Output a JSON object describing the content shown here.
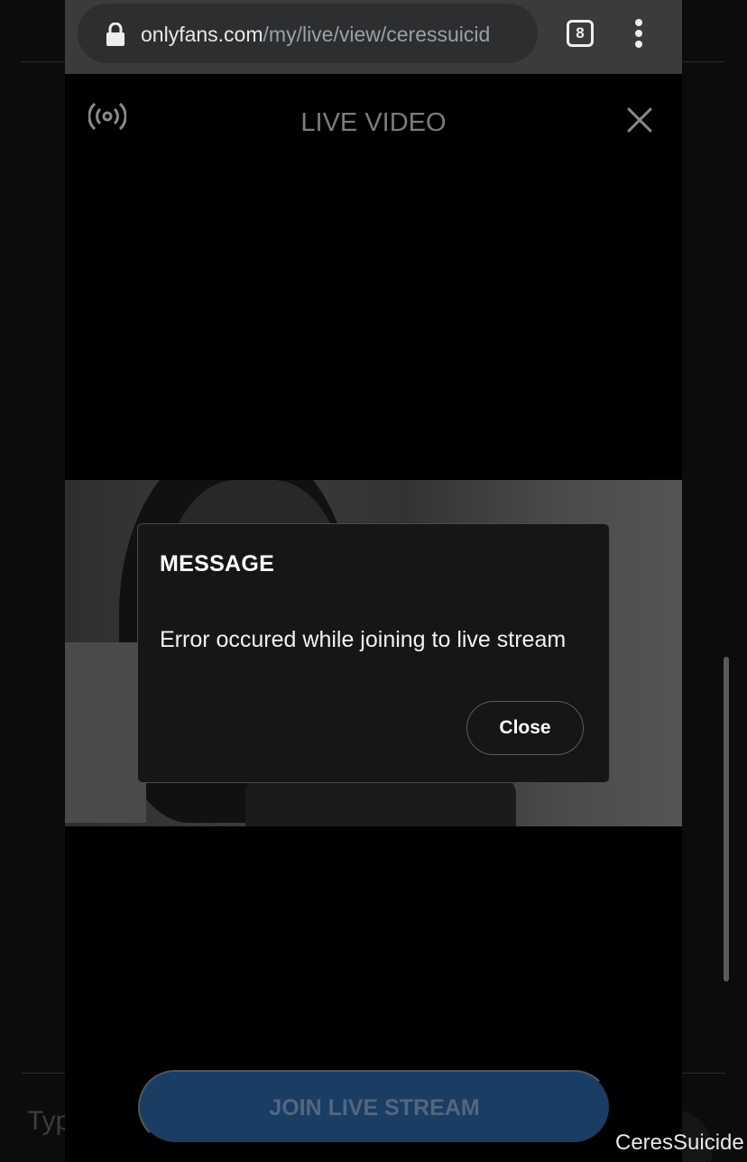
{
  "browser": {
    "url_domain": "onlyfans.com",
    "url_path": "/my/live/view/ceressuicid",
    "tab_count": "8",
    "icons": {
      "lock": "lock-icon",
      "tabs": "tabs-icon",
      "menu": "more-vert-icon"
    }
  },
  "live": {
    "title": "LIVE VIDEO",
    "icons": {
      "broadcast": "broadcast-icon",
      "close": "close-icon"
    }
  },
  "modal": {
    "title": "MESSAGE",
    "message": "Error occured while joining to live stream",
    "close_label": "Close"
  },
  "join_button": {
    "label": "JOIN LIVE STREAM"
  },
  "background": {
    "composer_text": "Typ"
  },
  "watermark": "CeresSuicide",
  "colors": {
    "urlbar": "#3a3b3d",
    "modal_bg": "#161618",
    "join_button": "#1a3d64",
    "join_text": "#52677e"
  }
}
